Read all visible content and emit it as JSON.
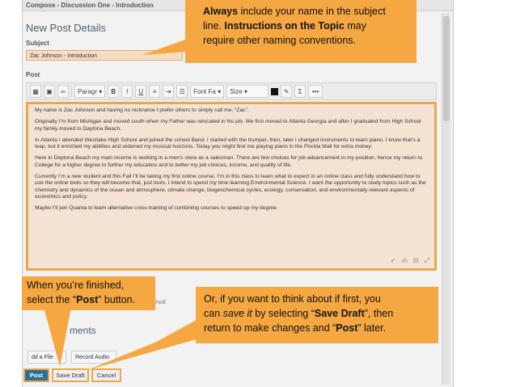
{
  "window": {
    "title": "Compose - Discussion One - Introduction"
  },
  "form": {
    "heading": "New Post Details",
    "subject_label": "Subject",
    "subject_value": "Zac Johnson - Introduction",
    "post_label": "Post"
  },
  "toolbar": {
    "paragraph_select": "Paragr",
    "bold": "B",
    "italic": "I",
    "underline": "U",
    "font_select": "Font Fa",
    "size_select": "Size",
    "sigma": "Σ",
    "more": "•••"
  },
  "editor": {
    "paragraphs": [
      "My name is Zac Johnson and having no nickname I prefer others to simply call me, “Zac”.",
      "Originally I’m from Michigan and moved south when my Father was relocated in his job. We first moved to Atlanta Georgia and after I graduated from High School my family moved to Daytona Beach.",
      "In Atlanta I attended Westlake High School and joined the school Band. I started with the trumpet, then, later I changed instruments to learn piano. I know that’s a leap, but it enriched my abilities and widened my musical horizons. Today you might find me playing piano in the Florida Mall for extra money.",
      "Here in Daytona Beach my main income is working in a men’s store as a salesman. There are few choices for job advancement in my position, hence my return to College for a higher degree to further my education and to better my job choices, income, and quality of life.",
      "Currently I’m a new student and this Fall I’ll be taking my first online course. I’m in this class to learn what to expect in an online class and fully understand how to use the online tools so they will become that, just tools. I intend to spend my time learning Environmental Science. I want the opportunity to study topics such as the chemistry and dynamics of the ocean and atmosphere, climate change, biogeochemical cycles, ecology, conservation, and environmentally relevant aspects of economics and policy.",
      "Maybe I’ll join Quanta to learn alternative cross-training of combining courses to speed-up my degree."
    ]
  },
  "background": {
    "partial_option": "ion method",
    "attachments_heading": "ments",
    "add_file": "dd a File",
    "record_audio": "Record Audio"
  },
  "actions": {
    "post": "Post",
    "save_draft": "Save Draft",
    "cancel": "Cancel"
  },
  "callouts": {
    "top": {
      "line1_bold": "Always",
      "line1_rest": " include your name in the subject",
      "line2_start": "line. ",
      "line2_bold": "Instructions on the Topic",
      "line2_end": " may",
      "line3": "require other naming conventions."
    },
    "left": {
      "line1": "When you’re finished,",
      "line2_start": "select the “",
      "line2_bold": "Post",
      "line2_end": "” button."
    },
    "right": {
      "line1": "Or, if you want to think about if first, you",
      "line2_start": "can ",
      "line2_italic": "save it",
      "line2_mid": " by selecting “",
      "line2_bold": "Save Draft",
      "line2_end": "”, then",
      "line3_start": "return to make changes and “",
      "line3_bold": "Post",
      "line3_end": "” later."
    }
  },
  "colors": {
    "callout": "#f5a742",
    "highlight_border": "#e8a94e",
    "post_button": "#2f6f92"
  }
}
